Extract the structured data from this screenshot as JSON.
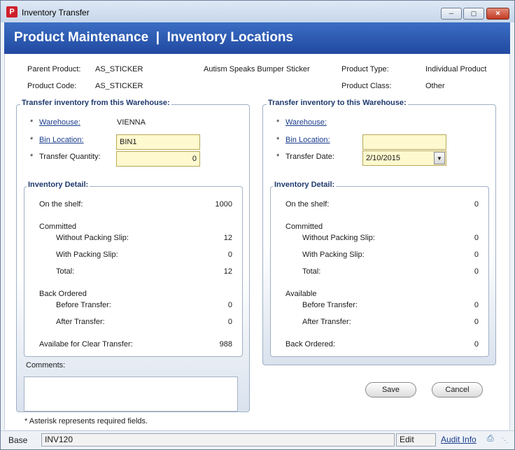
{
  "window": {
    "title": "Inventory Transfer",
    "app_icon": "P"
  },
  "header": {
    "title": "Product Maintenance  |  Inventory Locations"
  },
  "product": {
    "parent_label": "Parent Product:",
    "parent_value": "AS_STICKER",
    "description": "Autism Speaks Bumper Sticker",
    "type_label": "Product Type:",
    "type_value": "Individual Product",
    "code_label": "Product Code:",
    "code_value": "AS_STICKER",
    "class_label": "Product Class:",
    "class_value": "Other"
  },
  "from": {
    "title": "Transfer inventory from this Warehouse:",
    "req": "*",
    "warehouse_label": "Warehouse:",
    "warehouse_value": "VIENNA",
    "bin_label": "Bin Location:",
    "bin_value": "BIN1",
    "qty_label": "Transfer Quantity:",
    "qty_value": "0",
    "detail": {
      "title": "Inventory Detail:",
      "on_shelf_label": "On the shelf:",
      "on_shelf_value": "1000",
      "committed_label": "Committed",
      "without_slip_label": "Without Packing Slip:",
      "without_slip_value": "12",
      "with_slip_label": "With Packing Slip:",
      "with_slip_value": "0",
      "total_label": "Total:",
      "total_value": "12",
      "back_ordered_label": "Back Ordered",
      "before_label": "Before Transfer:",
      "before_value": "0",
      "after_label": "After Transfer:",
      "after_value": "0",
      "available_label": "Availabe for Clear Transfer:",
      "available_value": "988"
    },
    "comments_label": "Comments:"
  },
  "to": {
    "title": "Transfer inventory to this Warehouse:",
    "req": "*",
    "warehouse_label": "Warehouse:",
    "bin_label": "Bin Location:",
    "bin_value": "",
    "date_label": "Transfer Date:",
    "date_value": "2/10/2015",
    "detail": {
      "title": "Inventory Detail:",
      "on_shelf_label": "On the shelf:",
      "on_shelf_value": "0",
      "committed_label": "Committed",
      "without_slip_label": "Without Packing Slip:",
      "without_slip_value": "0",
      "with_slip_label": "With Packing Slip:",
      "with_slip_value": "0",
      "total_label": "Total:",
      "total_value": "0",
      "available_label": "Available",
      "before_label": "Before Transfer:",
      "before_value": "0",
      "after_label": "After Transfer:",
      "after_value": "0",
      "back_ordered_label": "Back Ordered:",
      "back_ordered_value": "0"
    }
  },
  "buttons": {
    "save": "Save",
    "cancel": "Cancel"
  },
  "footnote": "* Asterisk represents required fields.",
  "status": {
    "mode": "Base",
    "code": "INV120",
    "state": "Edit",
    "audit": "Audit Info"
  },
  "colors": {
    "header": "#2a57b0",
    "input_required": "#fff9cf",
    "link": "#1a3c8c"
  }
}
